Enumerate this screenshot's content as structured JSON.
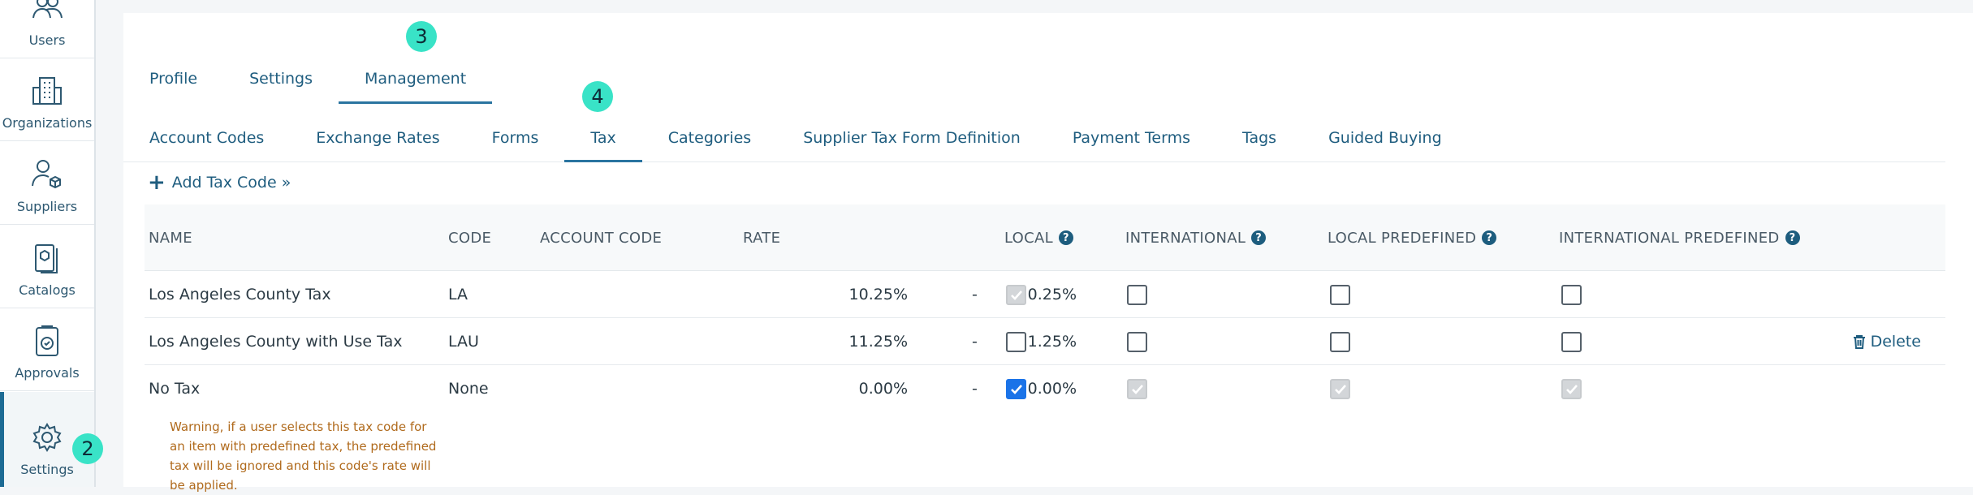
{
  "sidebar": {
    "items": [
      {
        "label": "Users",
        "icon": "users-icon"
      },
      {
        "label": "Organizations",
        "icon": "building-icon"
      },
      {
        "label": "Suppliers",
        "icon": "supplier-icon"
      },
      {
        "label": "Catalogs",
        "icon": "catalog-icon"
      },
      {
        "label": "Approvals",
        "icon": "approval-icon"
      },
      {
        "label": "Settings",
        "icon": "gear-icon"
      }
    ]
  },
  "badges": {
    "settings": "2",
    "management": "3",
    "tax": "4"
  },
  "tabs_main": [
    "Profile",
    "Settings",
    "Management"
  ],
  "tabs_sub": [
    "Account Codes",
    "Exchange Rates",
    "Forms",
    "Tax",
    "Categories",
    "Supplier Tax Form Definition",
    "Payment Terms",
    "Tags",
    "Guided Buying"
  ],
  "add_link": "Add Tax Code »",
  "table": {
    "headers": {
      "name": "NAME",
      "code": "CODE",
      "account_code": "ACCOUNT CODE",
      "rate": "RATE",
      "local": "LOCAL",
      "international": "INTERNATIONAL",
      "local_predefined": "LOCAL PREDEFINED",
      "international_predefined": "INTERNATIONAL PREDEFINED"
    },
    "rows": [
      {
        "name": "Los Angeles County Tax",
        "code": "LA",
        "rate_from": "10.25%",
        "sep": "-",
        "rate_to": "10.25%",
        "local": "checked-disabled",
        "international": "unchecked",
        "local_predefined": "unchecked",
        "international_predefined": "unchecked"
      },
      {
        "name": "Los Angeles County with Use Tax",
        "code": "LAU",
        "rate_from": "11.25%",
        "sep": "-",
        "rate_to": "11.25%",
        "local": "unchecked",
        "international": "unchecked",
        "local_predefined": "unchecked",
        "international_predefined": "unchecked",
        "action": "Delete"
      },
      {
        "name": "No Tax",
        "code": "None",
        "rate_from": "0.00%",
        "sep": "-",
        "rate_to": "0.00%",
        "local": "checked",
        "international": "checked-disabled",
        "local_predefined": "checked-disabled",
        "international_predefined": "checked-disabled",
        "warning": "Warning, if a user selects this tax code for an item with predefined tax, the predefined tax will be ignored and this code's rate will be applied."
      }
    ]
  },
  "colors": {
    "accent": "#1f5d7f",
    "badge": "#39e3c7",
    "warning": "#b06a1c",
    "checkbox": "#1a73e8"
  }
}
